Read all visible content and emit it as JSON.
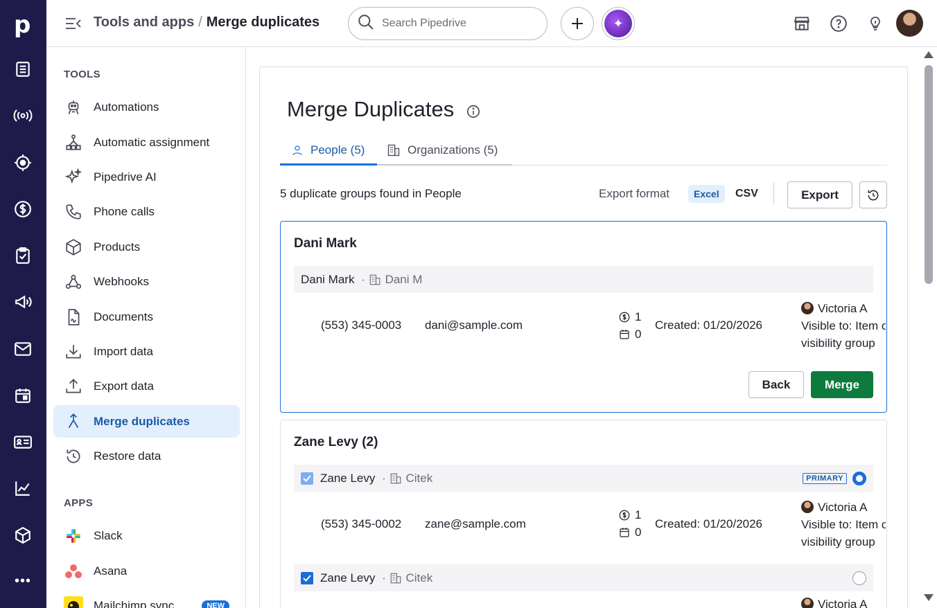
{
  "rail": {
    "logo": "p",
    "more": "•••"
  },
  "header": {
    "breadcrumb_parent": "Tools and apps",
    "breadcrumb_sep": "/",
    "breadcrumb_current": "Merge duplicates",
    "search_placeholder": "Search Pipedrive"
  },
  "sidebar": {
    "tools_title": "TOOLS",
    "tools": [
      {
        "label": "Automations",
        "icon": "robot-icon"
      },
      {
        "label": "Automatic assignment",
        "icon": "assignment-icon"
      },
      {
        "label": "Pipedrive AI",
        "icon": "sparkle-icon"
      },
      {
        "label": "Phone calls",
        "icon": "phone-icon"
      },
      {
        "label": "Products",
        "icon": "box-icon"
      },
      {
        "label": "Webhooks",
        "icon": "webhook-icon"
      },
      {
        "label": "Documents",
        "icon": "document-icon"
      },
      {
        "label": "Import data",
        "icon": "download-icon"
      },
      {
        "label": "Export data",
        "icon": "upload-icon"
      },
      {
        "label": "Merge duplicates",
        "icon": "merge-icon"
      },
      {
        "label": "Restore data",
        "icon": "restore-icon"
      }
    ],
    "apps_title": "APPS",
    "apps": [
      {
        "label": "Slack"
      },
      {
        "label": "Asana"
      },
      {
        "label": "Mailchimp sync",
        "badge": "NEW"
      }
    ]
  },
  "main": {
    "title": "Merge Duplicates",
    "tabs": [
      {
        "label": "People (5)"
      },
      {
        "label": "Organizations (5)"
      }
    ],
    "found_text": "5 duplicate groups found in People",
    "export_format_label": "Export format",
    "format_excel": "Excel",
    "format_csv": "CSV",
    "export_button": "Export",
    "groups": [
      {
        "title": "Dani Mark",
        "rows": [
          {
            "name": "Dani Mark",
            "org": "Dani M",
            "phone": "(553) 345-0003",
            "email": "dani@sample.com",
            "deals": "1",
            "activities": "0",
            "created": "Created: 01/20/2026",
            "owner": "Victoria A",
            "visibility_1": "Visible to: Item owner's",
            "visibility_2": "visibility group"
          }
        ],
        "back_button": "Back",
        "merge_button": "Merge"
      },
      {
        "title": "Zane Levy (2)",
        "rows": [
          {
            "name": "Zane Levy",
            "org": "Citek",
            "primary_badge": "PRIMARY",
            "phone": "(553) 345-0002",
            "email": "zane@sample.com",
            "deals": "1",
            "activities": "0",
            "created": "Created: 01/20/2026",
            "owner": "Victoria A",
            "visibility_1": "Visible to: Item owner's",
            "visibility_2": "visibility group"
          },
          {
            "name": "Zane Levy",
            "org": "Citek",
            "owner": "Victoria A"
          }
        ]
      }
    ]
  },
  "colors": {
    "rail_bg": "#1e1b4b",
    "accent_blue": "#1a6ed8",
    "merge_green": "#0d7a3e",
    "active_nav_bg": "#e3effc"
  }
}
